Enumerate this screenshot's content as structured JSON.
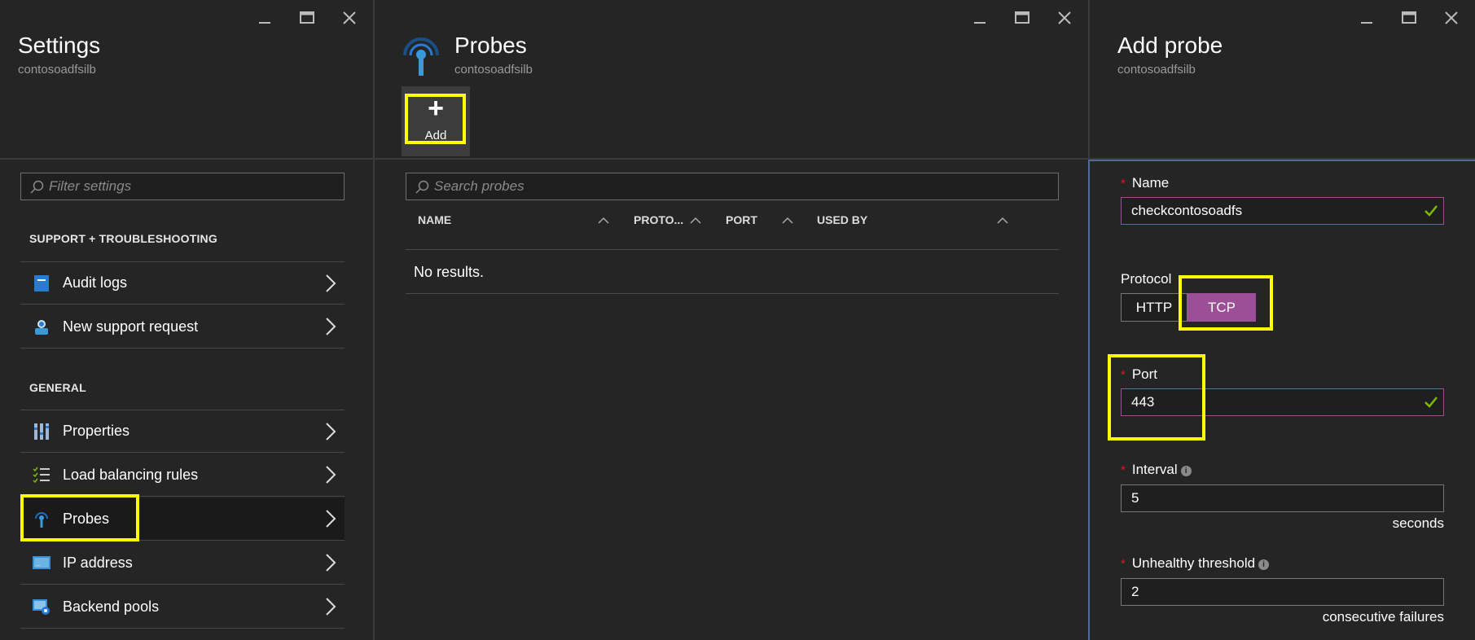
{
  "settings": {
    "title": "Settings",
    "subtitle": "contosoadfsilb",
    "filter_placeholder": "Filter settings",
    "sections": [
      {
        "heading": "SUPPORT + TROUBLESHOOTING",
        "items": [
          {
            "label": "Audit logs",
            "icon": "audit-log-icon"
          },
          {
            "label": "New support request",
            "icon": "support-request-icon"
          }
        ]
      },
      {
        "heading": "GENERAL",
        "items": [
          {
            "label": "Properties",
            "icon": "properties-icon"
          },
          {
            "label": "Load balancing rules",
            "icon": "load-balancing-rules-icon"
          },
          {
            "label": "Probes",
            "icon": "probe-icon"
          },
          {
            "label": "IP address",
            "icon": "ip-address-icon"
          },
          {
            "label": "Backend pools",
            "icon": "backend-pool-icon"
          }
        ]
      }
    ]
  },
  "probes": {
    "title": "Probes",
    "subtitle": "contosoadfsilb",
    "add_label": "Add",
    "search_placeholder": "Search probes",
    "columns": [
      "NAME",
      "PROTO...",
      "PORT",
      "USED BY"
    ],
    "empty_message": "No results."
  },
  "add_probe": {
    "title": "Add probe",
    "subtitle": "contosoadfsilb",
    "name_label": "Name",
    "name_value": "checkcontosoadfs",
    "protocol_label": "Protocol",
    "protocol_options": [
      "HTTP",
      "TCP"
    ],
    "protocol_selected": "TCP",
    "port_label": "Port",
    "port_value": "443",
    "interval_label": "Interval",
    "interval_value": "5",
    "interval_unit": "seconds",
    "threshold_label": "Unhealthy threshold",
    "threshold_value": "2",
    "threshold_unit": "consecutive failures"
  },
  "colors": {
    "accent_purple": "#9b4f96",
    "highlight_yellow": "#ffff00",
    "required_red": "#e81123",
    "valid_green": "#7fba00",
    "pane_border_blue": "#506c96"
  }
}
